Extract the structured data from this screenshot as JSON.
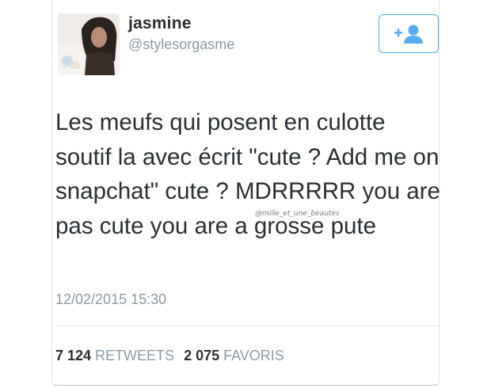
{
  "user": {
    "display_name": "jasmine",
    "handle": "@stylesorgasme"
  },
  "follow_button": {
    "icon": "add-user-icon",
    "color": "#55acee"
  },
  "tweet": {
    "text": "Les meufs qui posent en culotte soutif la avec écrit \"cute ? Add me on snapchat\"  cute ? MDRRRRR you are pas cute you are a grosse pute",
    "watermark": "@mille_et_une_beautes",
    "timestamp": "12/02/2015 15:30"
  },
  "stats": {
    "retweets_count": "7 124",
    "retweets_label": "RETWEETS",
    "favorites_count": "2 075",
    "favorites_label": "FAVORIS"
  },
  "colors": {
    "text": "#292f33",
    "muted": "#8899a6",
    "accent": "#55acee"
  }
}
